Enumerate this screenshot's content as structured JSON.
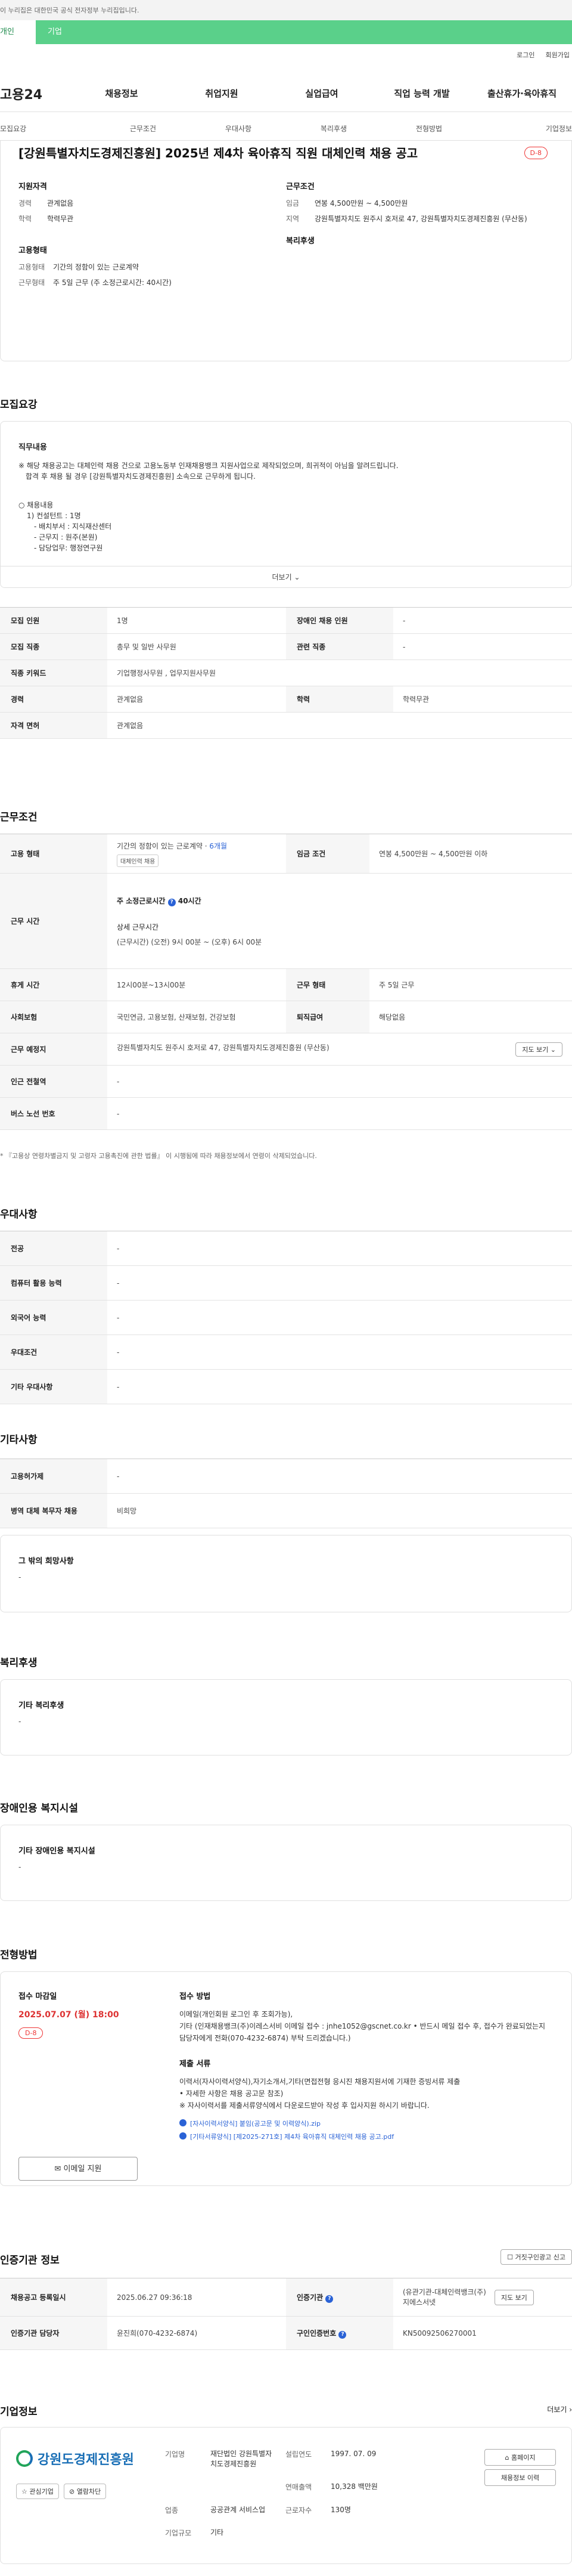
{
  "top_notice": "이 누리집은 대한민국 공식 전자정부 누리집입니다.",
  "tabs": [
    "개인",
    "기업"
  ],
  "util": [
    "로그인",
    "회원가입"
  ],
  "gnb": {
    "logo": "고용24",
    "menu": [
      "채용정보",
      "취업지원",
      "실업급여",
      "직업 능력 개발",
      "출산휴가·육아휴직"
    ]
  },
  "subnav": [
    "모집요강",
    "근무조건",
    "우대사항",
    "복리후생",
    "전형방법",
    "기업정보"
  ],
  "summary": {
    "title": "[강원특별자치도경제진흥원] 2025년 제4차 육아휴직 직원 대체인력 채용 공고",
    "dday": "D-8",
    "qual_head": "지원자격",
    "career_k": "경력",
    "career_v": "관계없음",
    "edu_k": "학력",
    "edu_v": "학력무관",
    "emp_head": "고용형태",
    "emptype_k": "고용형태",
    "emptype_v": "기간의 정함이 있는 근로계약",
    "worktype_k": "근무형태",
    "worktype_v": "주 5일 근무 (주 소정근로시간: 40시간)",
    "cond_head": "근무조건",
    "wage_k": "임금",
    "wage_v": "연봉 4,500만원 ~ 4,500만원",
    "region_k": "지역",
    "region_v": "강원특별자치도 원주시 호저로 47, 강원특별자치도경제진흥원 (무산동)",
    "welfare_head": "복리후생"
  },
  "recruit": {
    "section": "모집요강",
    "desc_title": "직무내용",
    "desc_p1": "※ 해당 채용공고는 대체인력 채용 건으로 고용노동부 인재채용뱅크 지원사업으로 제작되었으며, 희귀적이 아님을 알려드립니다.",
    "desc_p2": "합격 후 채용 될 경우 [강원특별자치도경제진흥원] 소속으로 근무하게 됩니다.",
    "desc_list": "○ 채용내용",
    "desc_l1": "1) 컨설턴트 : 1명",
    "desc_l2": "- 배치부서 : 지식재산센터",
    "desc_l3": "- 근무지 : 원주(본원)",
    "desc_l4": "- 담당업무: 행정연구원",
    "more": "더보기",
    "rows": {
      "count_k": "모집 인원",
      "count_v": "1명",
      "disabled_k": "장애인 채용 인원",
      "disabled_v": "-",
      "job_k": "모집 직종",
      "job_v": "총무 및 일반 사무원",
      "related_k": "관련 직종",
      "related_v": "-",
      "keyword_k": "직종 키워드",
      "keyword_v": "기업행정사무원 , 업무지원사무원",
      "career_k": "경력",
      "career_v": "관계없음",
      "edu_k": "학력",
      "edu_v": "학력무관",
      "license_k": "자격 면허",
      "license_v": "관계없음"
    }
  },
  "work": {
    "section": "근무조건",
    "emp_k": "고용 형태",
    "emp_v": "기간의 정함이 있는 근로계약 · ",
    "emp_months": "6개월",
    "emp_tag": "대체인력 채용",
    "wage_k": "임금 조건",
    "wage_v": "연봉 4,500만원 ~ 4,500만원 이하",
    "time_k": "근무 시간",
    "time_weekly_label": "주 소정근로시간",
    "time_weekly_val": "40시간",
    "time_detail_label": "상세 근무시간",
    "time_detail": "(근무시간) (오전) 9시 00분 ~ (오후) 6시 00분",
    "break_k": "휴게 시간",
    "break_v": "12시00분~13시00분",
    "form_k": "근무 형태",
    "form_v": "주 5일 근무",
    "insurance_k": "사회보험",
    "insurance_v": "국민연금, 고용보험, 산재보험, 건강보험",
    "retire_k": "퇴직급여",
    "retire_v": "해당없음",
    "place_k": "근무 예정지",
    "place_v": "강원특별자치도 원주시 호저로 47, 강원특별자치도경제진흥원 (무산동)",
    "map_btn": "지도 보기",
    "subway_k": "인근 전철역",
    "subway_v": "-",
    "bus_k": "버스 노선 번호",
    "bus_v": "-",
    "note": "* 『고용상 연령차별금지 및 고령자 고용촉진에 관한 법률』 이 시행됨에 따라 채용정보에서 연령이 삭제되었습니다."
  },
  "pref": {
    "section": "우대사항",
    "major_k": "전공",
    "major_v": "-",
    "pc_k": "컴퓨터 활용 능력",
    "pc_v": "-",
    "lang_k": "외국어 능력",
    "lang_v": "-",
    "cond_k": "우대조건",
    "cond_v": "-",
    "etc_k": "기타 우대사항",
    "etc_v": "-"
  },
  "etc": {
    "section": "기타사항",
    "permit_k": "고용허가제",
    "permit_v": "-",
    "military_k": "병역 대체 복무자 채용",
    "military_v": "비희망",
    "hope_title": "그 밖의 희망사항",
    "hope_v": "-"
  },
  "welfare": {
    "section": "복리후생",
    "title": "기타 복리후생",
    "v": "-"
  },
  "disabled": {
    "section": "장애인용 복지시설",
    "title": "기타 장애인용 복지시설",
    "v": "-"
  },
  "process": {
    "section": "전형방법",
    "due_label": "접수 마감일",
    "due": "2025.07.07 (월) 18:00",
    "dday": "D-8",
    "email_btn": "이메일 지원",
    "method_label": "접수 방법",
    "method_p1": "이메일(개인회원 로그인 후 조회가능),",
    "method_p2": "기타 (인재채용뱅크(주)이레스서비 이메일 접수 : jnhe1052@gscnet.co.kr • 반드시 메일 접수 후, 접수가 완료되었는지 담당자에게 전화(070-4232-6874) 부탁 드리겠습니다.)",
    "docs_label": "제출 서류",
    "docs_p1": "이력서(자사이력서양식),자기소개서,기타(면접전형 응시진 채용지원서에 기재한 증빙서류 제출",
    "docs_p2": "• 자세한 사항은 채용 공고문 참조)",
    "docs_p3": "※ 자사이력서를 제출서류양식에서 다운로드받아 작성 후 입사지원 하시기 바랍니다.",
    "file1": "[자사이력서양식] 붙임(공고문 및 이력양식).zip",
    "file2": "[기타서류양식] [제2025-271호] 제4차 육아휴직 대체인력 채용 공고.pdf"
  },
  "agency": {
    "section": "인증기관 정보",
    "report_btn": "거짓구인광고 신고",
    "date_k": "채용공고 등록일시",
    "date_v": "2025.06.27 09:36:18",
    "org_k": "인증기관",
    "org_v": "(유관기관-대체인력뱅크(주)지에스서넷",
    "org_btn": "지도 보기",
    "mgr_k": "인증기관 담당자",
    "mgr_v": "윤진희(070-4232-6874)",
    "num_k": "구인인증번호",
    "num_v": "KN50092506270001"
  },
  "company": {
    "section": "기업정보",
    "more": "더보기",
    "logo_text": "강원도경제진흥원",
    "fav_btn": "관심기업",
    "block_btn": "열람차단",
    "name_k": "기업명",
    "name_v": "재단법인 강원특별자치도경제진흥원",
    "found_k": "설립연도",
    "found_v": "1997. 07. 09",
    "sales_k": "연매출액",
    "sales_v": "10,328 백만원",
    "type_k": "업종",
    "type_v": "공공관계 서비스업",
    "emp_k": "근로자수",
    "emp_v": "130명",
    "size_k": "기업규모",
    "size_v": "기타",
    "home_btn": "홈페이지",
    "list_btn": "채용정보 이력"
  }
}
